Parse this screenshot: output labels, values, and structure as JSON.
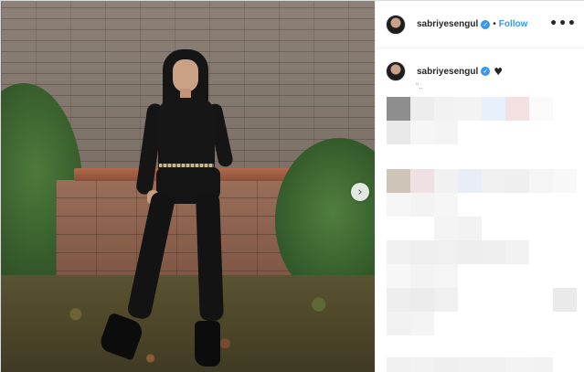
{
  "post": {
    "username": "sabriyesengul",
    "verified_glyph": "✓",
    "separator": "•",
    "follow_label": "Follow",
    "more_label": "•••",
    "caption_username": "sabriyesengul",
    "caption_emoji": "♥",
    "caption_snippet": "“..",
    "next_arrow": "›"
  },
  "icons": {
    "verified": "verified-badge-icon",
    "more": "more-options-icon",
    "next": "chevron-right-icon",
    "heart": "black-heart-icon"
  },
  "colors": {
    "accent": "#3897f0",
    "text": "#262626",
    "border": "#efefef"
  }
}
